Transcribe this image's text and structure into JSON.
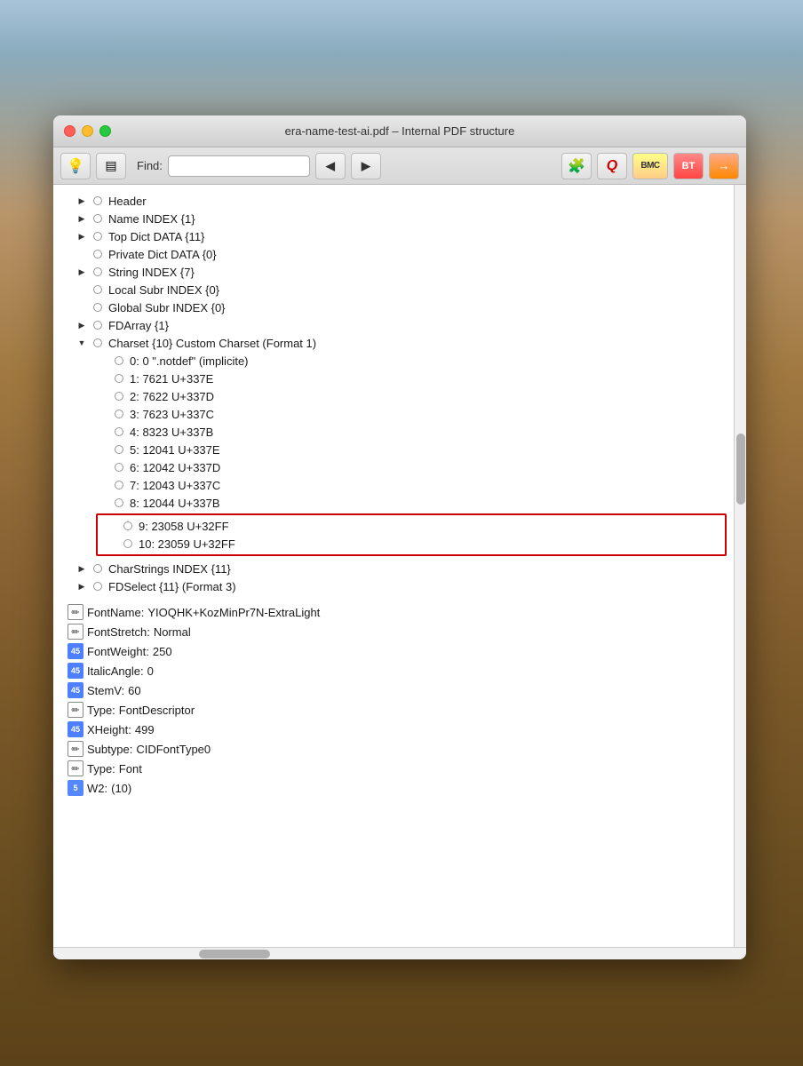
{
  "window": {
    "title": "era-name-test-ai.pdf – Internal PDF structure"
  },
  "toolbar": {
    "find_label": "Find:",
    "find_placeholder": "",
    "btn_lightbulb": "💡",
    "btn_tree": "▤",
    "btn_prev": "◀",
    "btn_next": "▶",
    "btn_puzzle": "🧩",
    "btn_q": "Q",
    "btn_bmc": "BMC",
    "btn_bt": "BT",
    "btn_arrow": "→"
  },
  "tree": {
    "items": [
      {
        "id": "header",
        "indent": 1,
        "arrow": "collapsed",
        "label": "Header"
      },
      {
        "id": "name-index",
        "indent": 1,
        "arrow": "collapsed",
        "label": "Name INDEX {1}"
      },
      {
        "id": "top-dict",
        "indent": 1,
        "arrow": "collapsed",
        "label": "Top Dict DATA {11}"
      },
      {
        "id": "private-dict",
        "indent": 1,
        "arrow": "none",
        "label": "Private Dict DATA {0}"
      },
      {
        "id": "string-index",
        "indent": 1,
        "arrow": "collapsed",
        "label": "String INDEX {7}"
      },
      {
        "id": "local-subr",
        "indent": 1,
        "arrow": "none",
        "label": "Local Subr INDEX {0}"
      },
      {
        "id": "global-subr",
        "indent": 1,
        "arrow": "none",
        "label": "Global Subr INDEX {0}"
      },
      {
        "id": "fdarray",
        "indent": 1,
        "arrow": "collapsed",
        "label": "FDArray {1}"
      },
      {
        "id": "charset",
        "indent": 1,
        "arrow": "expanded",
        "label": "Charset {10} Custom Charset (Format 1)"
      },
      {
        "id": "charset-0",
        "indent": 2,
        "arrow": "none",
        "label": "0: 0 \".notdef\"  (implicite)"
      },
      {
        "id": "charset-1",
        "indent": 2,
        "arrow": "none",
        "label": "1: 7621 U+337E"
      },
      {
        "id": "charset-2",
        "indent": 2,
        "arrow": "none",
        "label": "2: 7622 U+337D"
      },
      {
        "id": "charset-3",
        "indent": 2,
        "arrow": "none",
        "label": "3: 7623 U+337C"
      },
      {
        "id": "charset-4",
        "indent": 2,
        "arrow": "none",
        "label": "4: 8323 U+337B"
      },
      {
        "id": "charset-5",
        "indent": 2,
        "arrow": "none",
        "label": "5: 12041 U+337E"
      },
      {
        "id": "charset-6",
        "indent": 2,
        "arrow": "none",
        "label": "6: 12042 U+337D"
      },
      {
        "id": "charset-7",
        "indent": 2,
        "arrow": "none",
        "label": "7: 12043 U+337C"
      },
      {
        "id": "charset-8",
        "indent": 2,
        "arrow": "none",
        "label": "8: 12044 U+337B"
      },
      {
        "id": "charset-9",
        "indent": 2,
        "arrow": "none",
        "label": "9: 23058 U+32FF",
        "highlighted": true
      },
      {
        "id": "charset-10",
        "indent": 2,
        "arrow": "none",
        "label": "10: 23059 U+32FF",
        "highlighted": true
      },
      {
        "id": "charstrings",
        "indent": 1,
        "arrow": "collapsed",
        "label": "CharStrings INDEX {11}"
      },
      {
        "id": "fdselect",
        "indent": 1,
        "arrow": "collapsed",
        "label": "FDSelect {11} (Format 3)"
      }
    ],
    "properties": [
      {
        "id": "fontname",
        "badge": "pencil",
        "key": "FontName:",
        "value": "YIOQHK+KozMinPr7N-ExtraLight"
      },
      {
        "id": "fontstretch",
        "badge": "pencil",
        "key": "FontStretch:",
        "value": "Normal"
      },
      {
        "id": "fontweight",
        "badge": "45",
        "key": "FontWeight:",
        "value": "250"
      },
      {
        "id": "italicangle",
        "badge": "45",
        "key": "ItalicAngle:",
        "value": "0"
      },
      {
        "id": "stemv",
        "badge": "45",
        "key": "StemV:",
        "value": "60"
      },
      {
        "id": "type",
        "badge": "pencil",
        "key": "Type:",
        "value": "FontDescriptor"
      },
      {
        "id": "xheight",
        "badge": "45",
        "key": "XHeight:",
        "value": "499"
      },
      {
        "id": "subtype",
        "badge": "pencil",
        "key": "Subtype:",
        "value": "CIDFontType0"
      },
      {
        "id": "type2",
        "badge": "pencil",
        "key": "Type:",
        "value": "Font"
      },
      {
        "id": "w2",
        "badge": "45",
        "key": "W2:",
        "value": "(10)"
      }
    ]
  }
}
